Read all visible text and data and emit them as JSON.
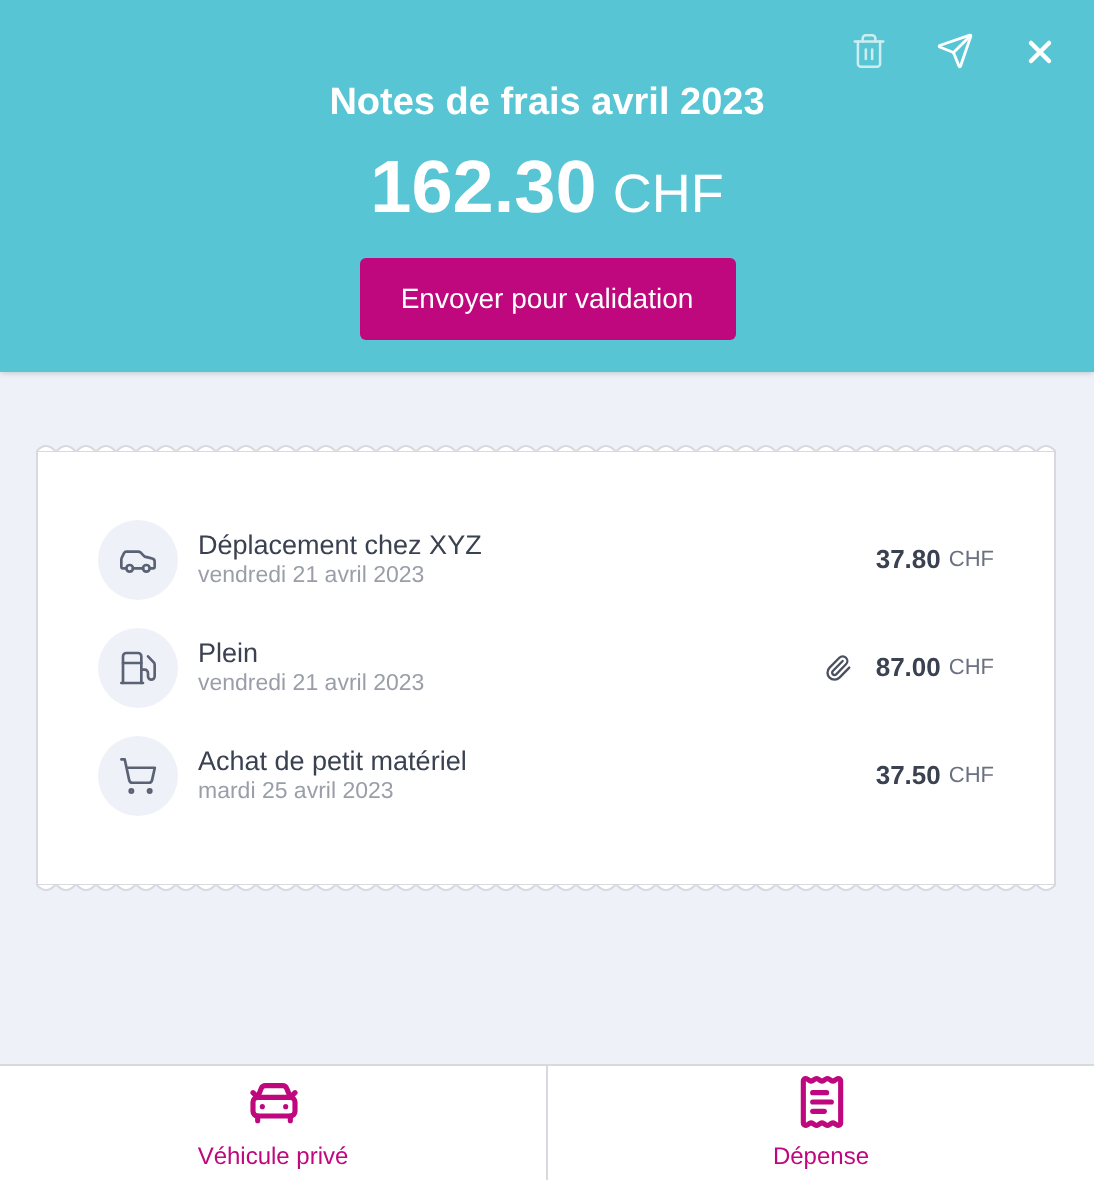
{
  "header": {
    "title": "Notes de frais avril 2023",
    "total": "162.30",
    "currency": "CHF",
    "button": "Envoyer pour validation"
  },
  "expenses": [
    {
      "kind": "car",
      "name": "Déplacement chez XYZ",
      "date": "vendredi 21 avril 2023",
      "amount": "37.80",
      "currency": "CHF",
      "attachment": false
    },
    {
      "kind": "fuel",
      "name": "Plein",
      "date": "vendredi 21 avril 2023",
      "amount": "87.00",
      "currency": "CHF",
      "attachment": true
    },
    {
      "kind": "cart",
      "name": "Achat de petit matériel",
      "date": "mardi 25 avril 2023",
      "amount": "37.50",
      "currency": "CHF",
      "attachment": false
    }
  ],
  "bottom_actions": [
    {
      "kind": "car",
      "label": "Véhicule privé"
    },
    {
      "kind": "receipt",
      "label": "Dépense"
    }
  ]
}
